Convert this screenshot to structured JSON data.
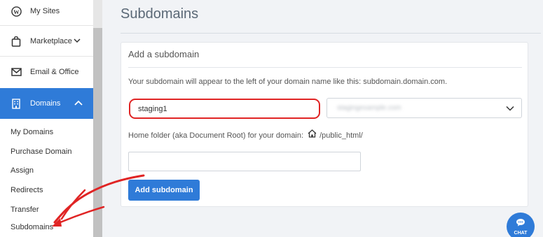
{
  "sidebar": {
    "items": [
      {
        "label": "My Sites",
        "icon": "wordpress-icon"
      },
      {
        "label": "Marketplace",
        "icon": "shopping-bag-icon"
      },
      {
        "label": "Email & Office",
        "icon": "email-icon"
      },
      {
        "label": "Domains",
        "icon": "building-icon"
      }
    ],
    "sub_items": [
      "My Domains",
      "Purchase Domain",
      "Assign",
      "Redirects",
      "Transfer",
      "Subdomains"
    ]
  },
  "main": {
    "title": "Subdomains",
    "card": {
      "title": "Add a subdomain",
      "help_text": "Your subdomain will appear to the left of your domain name like this: subdomain.domain.com.",
      "subdomain_value": "staging1",
      "domain_select_value": "stagingexample.com",
      "home_folder_label": "Home folder (aka Document Root) for your domain:",
      "home_folder_path": "/public_html/",
      "folder_value": "",
      "add_button": "Add subdomain"
    }
  },
  "chat": {
    "label": "CHAT"
  },
  "colors": {
    "accent": "#2f7bd8",
    "highlight": "#e02424"
  }
}
